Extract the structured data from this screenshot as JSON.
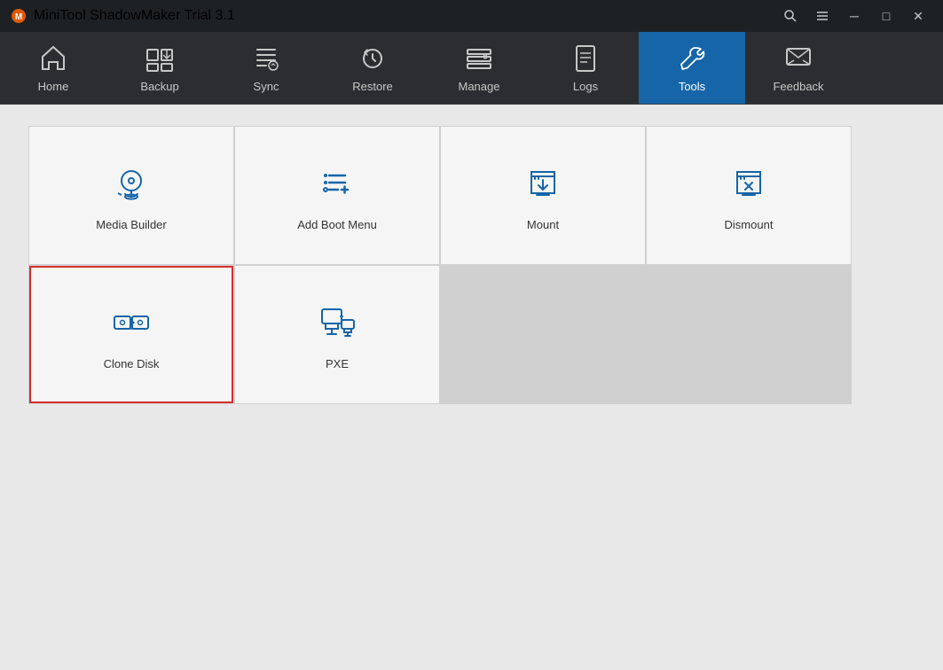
{
  "titlebar": {
    "title": "MiniTool ShadowMaker Trial 3.1",
    "controls": {
      "search": "🔍",
      "menu": "☰",
      "minimize": "─",
      "maximize": "□",
      "close": "✕"
    }
  },
  "navbar": {
    "items": [
      {
        "id": "home",
        "label": "Home",
        "active": false
      },
      {
        "id": "backup",
        "label": "Backup",
        "active": false
      },
      {
        "id": "sync",
        "label": "Sync",
        "active": false
      },
      {
        "id": "restore",
        "label": "Restore",
        "active": false
      },
      {
        "id": "manage",
        "label": "Manage",
        "active": false
      },
      {
        "id": "logs",
        "label": "Logs",
        "active": false
      },
      {
        "id": "tools",
        "label": "Tools",
        "active": true
      },
      {
        "id": "feedback",
        "label": "Feedback",
        "active": false
      }
    ]
  },
  "tools": {
    "items": [
      {
        "id": "media-builder",
        "label": "Media Builder",
        "selected": false
      },
      {
        "id": "add-boot-menu",
        "label": "Add Boot Menu",
        "selected": false
      },
      {
        "id": "mount",
        "label": "Mount",
        "selected": false
      },
      {
        "id": "dismount",
        "label": "Dismount",
        "selected": false
      },
      {
        "id": "clone-disk",
        "label": "Clone Disk",
        "selected": true
      },
      {
        "id": "pxe",
        "label": "PXE",
        "selected": false
      }
    ]
  }
}
